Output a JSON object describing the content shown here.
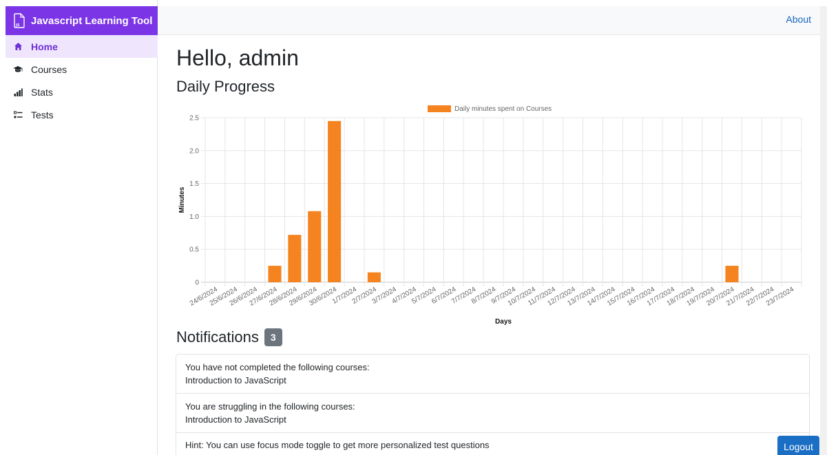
{
  "app": {
    "title": "Javascript Learning Tool",
    "brand_color": "#7b35e6"
  },
  "sidebar": {
    "items": [
      {
        "label": "Home",
        "icon": "home-icon",
        "active": true
      },
      {
        "label": "Courses",
        "icon": "graduation-cap-icon",
        "active": false
      },
      {
        "label": "Stats",
        "icon": "bar-chart-icon",
        "active": false
      },
      {
        "label": "Tests",
        "icon": "list-checks-icon",
        "active": false
      }
    ]
  },
  "topbar": {
    "about_label": "About"
  },
  "main": {
    "greeting": "Hello, admin",
    "progress_title": "Daily Progress",
    "notifications_title": "Notifications",
    "notifications_count": "3",
    "notifications": [
      {
        "line1": "You have not completed the following courses:",
        "line2": "Introduction to JavaScript"
      },
      {
        "line1": "You are struggling in the following courses:",
        "line2": "Introduction to JavaScript"
      },
      {
        "line1": "Hint: You can use focus mode toggle to get more personalized test questions",
        "line2": ""
      }
    ]
  },
  "logout_label": "Logout",
  "chart_data": {
    "type": "bar",
    "title": "",
    "xlabel": "Days",
    "ylabel": "Minutes",
    "ylim": [
      0,
      2.5
    ],
    "yticks": [
      "0",
      "0.5",
      "1.0",
      "1.5",
      "2.0",
      "2.5"
    ],
    "grid": true,
    "legend_position": "top",
    "bar_color": "#f5831f",
    "categories": [
      "24/6/2024",
      "25/6/2024",
      "26/6/2024",
      "27/6/2024",
      "28/6/2024",
      "29/6/2024",
      "30/6/2024",
      "1/7/2024",
      "2/7/2024",
      "3/7/2024",
      "4/7/2024",
      "5/7/2024",
      "6/7/2024",
      "7/7/2024",
      "8/7/2024",
      "9/7/2024",
      "10/7/2024",
      "11/7/2024",
      "12/7/2024",
      "13/7/2024",
      "14/7/2024",
      "15/7/2024",
      "16/7/2024",
      "17/7/2024",
      "18/7/2024",
      "19/7/2024",
      "20/7/2024",
      "21/7/2024",
      "22/7/2024",
      "23/7/2024"
    ],
    "series": [
      {
        "name": "Daily minutes spent on Courses",
        "values": [
          0,
          0,
          0,
          0.25,
          0.72,
          1.08,
          2.45,
          0,
          0.15,
          0,
          0,
          0,
          0,
          0,
          0,
          0,
          0,
          0,
          0,
          0,
          0,
          0,
          0,
          0,
          0,
          0,
          0.25,
          0,
          0,
          0
        ]
      }
    ]
  }
}
